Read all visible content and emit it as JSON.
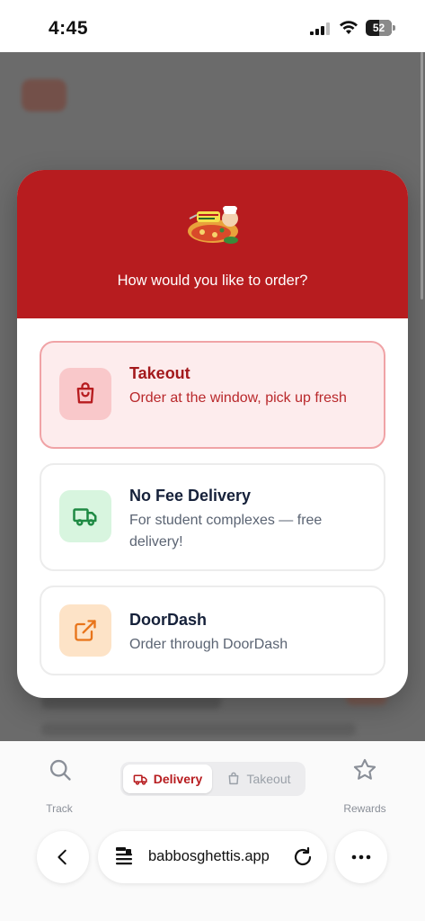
{
  "status_bar": {
    "time": "4:45",
    "battery_level": "52"
  },
  "modal": {
    "question": "How would you like to order?",
    "options": [
      {
        "title": "Takeout",
        "description": "Order at the window, pick up fresh",
        "icon": "shopping-bag-icon",
        "selected": true,
        "accent": "#b71c1f"
      },
      {
        "title": "No Fee Delivery",
        "description": "For student complexes — free delivery!",
        "icon": "truck-icon",
        "selected": false,
        "accent": "#1f8a44"
      },
      {
        "title": "DoorDash",
        "description": "Order through DoorDash",
        "icon": "external-link-icon",
        "selected": false,
        "accent": "#e8741a"
      }
    ]
  },
  "tab_bar": {
    "track_label": "Track",
    "rewards_label": "Rewards",
    "segments": {
      "delivery": "Delivery",
      "takeout": "Takeout",
      "selected": "Delivery"
    }
  },
  "browser": {
    "url": "babbosghettis.app"
  },
  "colors": {
    "brand_red": "#b71c1f",
    "selected_option_bg": "#fdeced",
    "delivery_green": "#1f8a44",
    "doordash_orange": "#e8741a"
  }
}
